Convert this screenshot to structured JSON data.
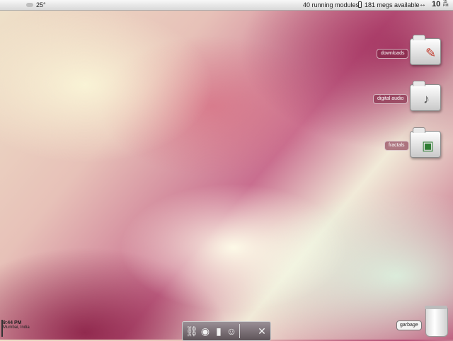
{
  "menubar": {
    "apple_glyph": "",
    "temperature": "25°",
    "modules_status": "40 running modules",
    "memory_status": "181 megs available",
    "network_glyph": "↔",
    "clock_hour_minute": "10",
    "clock_sub_top": "15",
    "clock_sub_bottom": "PM"
  },
  "desktop_icons": [
    {
      "label": "downloads"
    },
    {
      "label": "digital audio"
    },
    {
      "label": "fractals"
    }
  ],
  "trash": {
    "label": "garbage"
  },
  "world_clock": {
    "time": "9:44 PM",
    "place": "Mumbai, India"
  },
  "dock": {
    "items": [
      "link-icon",
      "disc-icon",
      "usb-icon",
      "finder-icon",
      "apple-icon",
      "tools-icon"
    ],
    "glyphs": [
      "⛓",
      "◉",
      "▮",
      "☺",
      "",
      "✕"
    ]
  }
}
